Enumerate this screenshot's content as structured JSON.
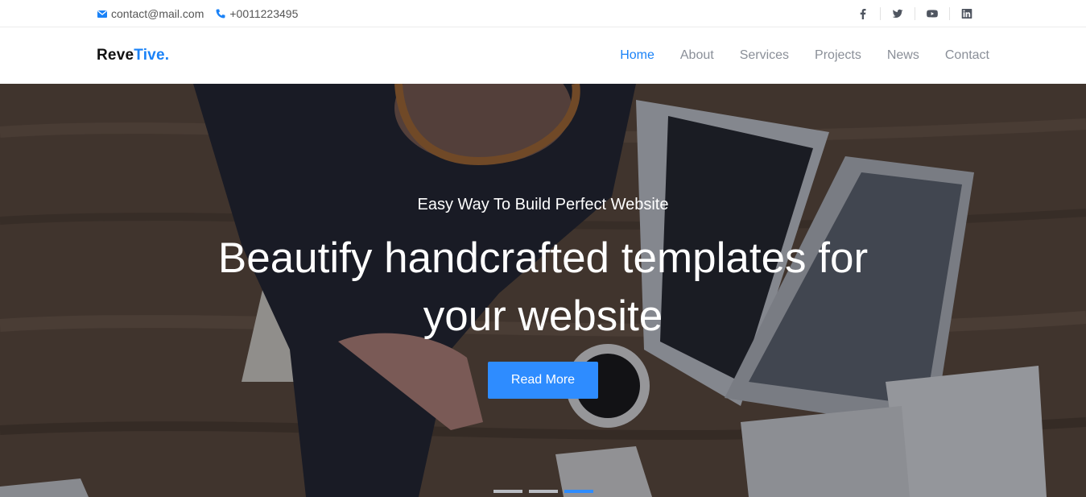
{
  "topbar": {
    "email": "contact@mail.com",
    "phone": "+0011223495",
    "icons": {
      "email": "envelope-icon",
      "phone": "phone-icon"
    },
    "social": [
      "facebook-icon",
      "twitter-icon",
      "youtube-icon",
      "linkedin-icon"
    ]
  },
  "brand": {
    "part1": "Reve",
    "part2": "Tive."
  },
  "nav": {
    "items": [
      {
        "label": "Home",
        "active": true
      },
      {
        "label": "About",
        "active": false
      },
      {
        "label": "Services",
        "active": false
      },
      {
        "label": "Projects",
        "active": false
      },
      {
        "label": "News",
        "active": false
      },
      {
        "label": "Contact",
        "active": false
      }
    ]
  },
  "hero": {
    "subtitle": "Easy Way To Build Perfect Website",
    "title_line1": "Beautify handcrafted templates for",
    "title_line2": "your website",
    "button": "Read More",
    "slides": 3,
    "active_slide": 3
  },
  "colors": {
    "accent": "#1a82f7",
    "button": "#2e8cff",
    "nav_text": "#8a8f98"
  }
}
